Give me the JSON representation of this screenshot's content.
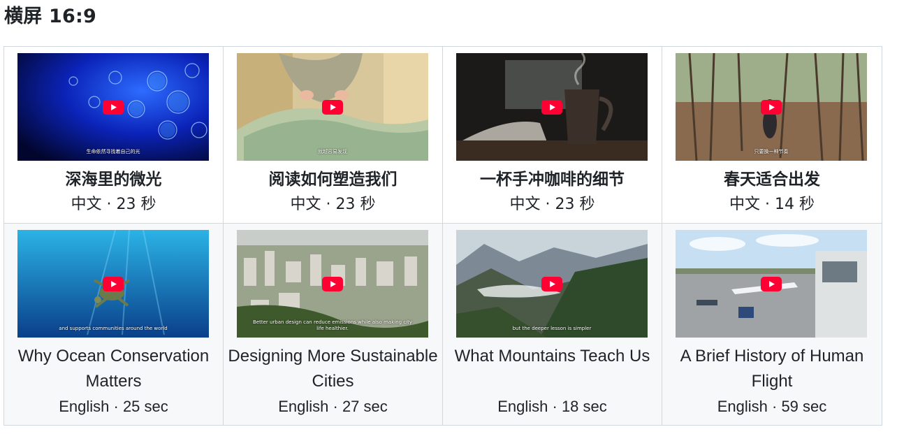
{
  "page": {
    "title": "横屏 16:9"
  },
  "videos": [
    {
      "title": "深海里的微光",
      "meta": "中文 · 23 秒",
      "subtitle": "生命依然寻找着自己的光",
      "thumb_icon": "jellyfish-scene"
    },
    {
      "title": "阅读如何塑造我们",
      "meta": "中文 · 23 秒",
      "subtitle": "就越容易发现",
      "thumb_icon": "reading-scene"
    },
    {
      "title": "一杯手冲咖啡的细节",
      "meta": "中文 · 23 秒",
      "subtitle": "",
      "thumb_icon": "coffee-scene"
    },
    {
      "title": "春天适合出发",
      "meta": "中文 · 14 秒",
      "subtitle": "只要换一种节奏",
      "thumb_icon": "forest-scene"
    },
    {
      "title": "Why Ocean Conservation Matters",
      "meta": "English · 25 sec",
      "subtitle": "and supports communities around the world",
      "thumb_icon": "ocean-turtle-scene"
    },
    {
      "title": "Designing More Sustainable Cities",
      "meta": "English · 27 sec",
      "subtitle": "Better urban design can reduce emissions while also making city life healthier.",
      "thumb_icon": "city-scene"
    },
    {
      "title": "What Mountains Teach Us",
      "meta": "English · 18 sec",
      "subtitle": "but the deeper lesson is simpler",
      "thumb_icon": "mountain-scene"
    },
    {
      "title": "A Brief History of Human Flight",
      "meta": "English · 59 sec",
      "subtitle": "",
      "thumb_icon": "airport-scene"
    }
  ],
  "colors": {
    "play_button": "#ff0033",
    "border": "#d0d7de",
    "row2_background": "#f6f8fa"
  }
}
